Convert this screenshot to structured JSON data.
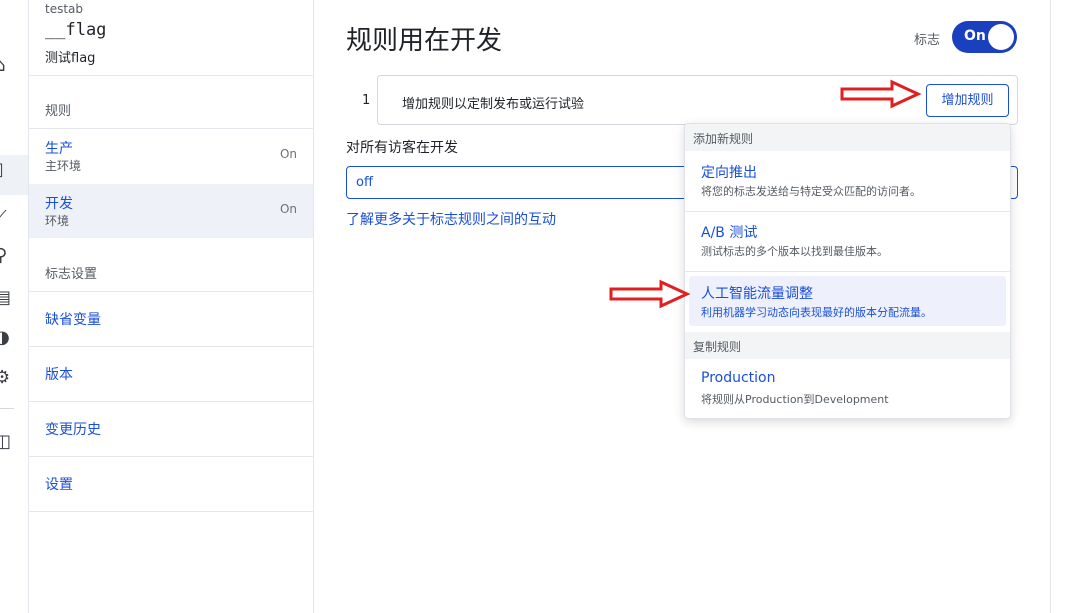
{
  "sidebar": {
    "project": "testab",
    "flag_key": "__flag",
    "flag_name": "测试flag",
    "rules_section": "规则",
    "environments": [
      {
        "name": "生产",
        "desc": "主环境",
        "status": "On"
      },
      {
        "name": "开发",
        "desc": "环境",
        "status": "On"
      }
    ],
    "settings_section": "标志设置",
    "links": [
      "缺省变量",
      "版本",
      "变更历史",
      "设置"
    ]
  },
  "main": {
    "title": "规则用在开发",
    "toggle_label": "标志",
    "toggle_state": "On",
    "rule_number": "1",
    "rule_prompt": "增加规则以定制发布或运行试验",
    "add_rule_button": "增加规则",
    "default_label": "对所有访客在开发",
    "default_value": "off",
    "learn_more": "了解更多关于标志规则之间的互动"
  },
  "menu": {
    "add_header": "添加新规则",
    "items": [
      {
        "title": "定向推出",
        "desc": "将您的标志发送给与特定受众匹配的访问者。"
      },
      {
        "title": "A/B 测试",
        "desc": "测试标志的多个版本以找到最佳版本。"
      },
      {
        "title": "人工智能流量调整",
        "desc": "利用机器学习动态向表现最好的版本分配流量。"
      }
    ],
    "copy_header": "复制规则",
    "copy_item": {
      "title": "Production",
      "desc": "将规则从Production到Development"
    }
  },
  "colors": {
    "accent": "#1a4fd8",
    "toggle": "#1a3fbf",
    "annotation_arrow": "#e02020"
  },
  "icons": [
    "nav-icon",
    "annotation-arrow-icon"
  ]
}
